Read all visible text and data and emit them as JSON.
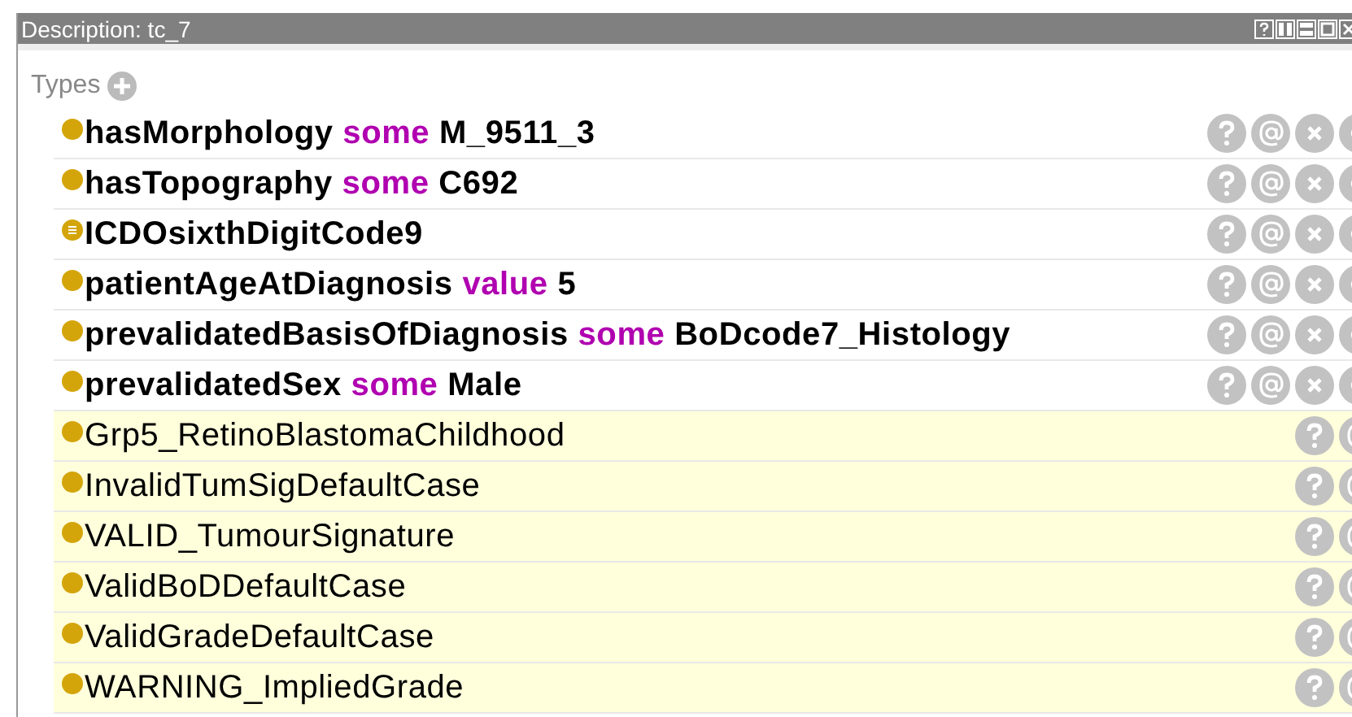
{
  "window": {
    "title": "Description: tc_7"
  },
  "section": {
    "label": "Types"
  },
  "rows": [
    {
      "inferred": false,
      "kind": "plain",
      "parts": [
        {
          "kind": "name",
          "text": "hasMorphology"
        },
        {
          "kind": "keyword",
          "text": "some"
        },
        {
          "kind": "value",
          "text": "M_9511_3"
        }
      ]
    },
    {
      "inferred": false,
      "kind": "plain",
      "parts": [
        {
          "kind": "name",
          "text": "hasTopography"
        },
        {
          "kind": "keyword",
          "text": "some"
        },
        {
          "kind": "value",
          "text": "C692"
        }
      ]
    },
    {
      "inferred": false,
      "kind": "lines",
      "parts": [
        {
          "kind": "name",
          "text": "ICDOsixthDigitCode9"
        }
      ]
    },
    {
      "inferred": false,
      "kind": "plain",
      "parts": [
        {
          "kind": "name",
          "text": "patientAgeAtDiagnosis"
        },
        {
          "kind": "keyword",
          "text": "value"
        },
        {
          "kind": "value",
          "text": "5"
        }
      ]
    },
    {
      "inferred": false,
      "kind": "plain",
      "parts": [
        {
          "kind": "name",
          "text": "prevalidatedBasisOfDiagnosis"
        },
        {
          "kind": "keyword",
          "text": "some"
        },
        {
          "kind": "value",
          "text": "BoDcode7_Histology"
        }
      ]
    },
    {
      "inferred": false,
      "kind": "plain",
      "parts": [
        {
          "kind": "name",
          "text": "prevalidatedSex"
        },
        {
          "kind": "keyword",
          "text": "some"
        },
        {
          "kind": "value",
          "text": "Male"
        }
      ]
    },
    {
      "inferred": true,
      "kind": "plain",
      "parts": [
        {
          "kind": "name",
          "text": "Grp5_RetinoBlastomaChildhood"
        }
      ]
    },
    {
      "inferred": true,
      "kind": "plain",
      "parts": [
        {
          "kind": "name",
          "text": "InvalidTumSigDefaultCase"
        }
      ]
    },
    {
      "inferred": true,
      "kind": "plain",
      "parts": [
        {
          "kind": "name",
          "text": "VALID_TumourSignature"
        }
      ]
    },
    {
      "inferred": true,
      "kind": "plain",
      "parts": [
        {
          "kind": "name",
          "text": "ValidBoDDefaultCase"
        }
      ]
    },
    {
      "inferred": true,
      "kind": "plain",
      "parts": [
        {
          "kind": "name",
          "text": "ValidGradeDefaultCase"
        }
      ]
    },
    {
      "inferred": true,
      "kind": "plain",
      "parts": [
        {
          "kind": "name",
          "text": "WARNING_ImpliedGrade"
        }
      ]
    }
  ]
}
